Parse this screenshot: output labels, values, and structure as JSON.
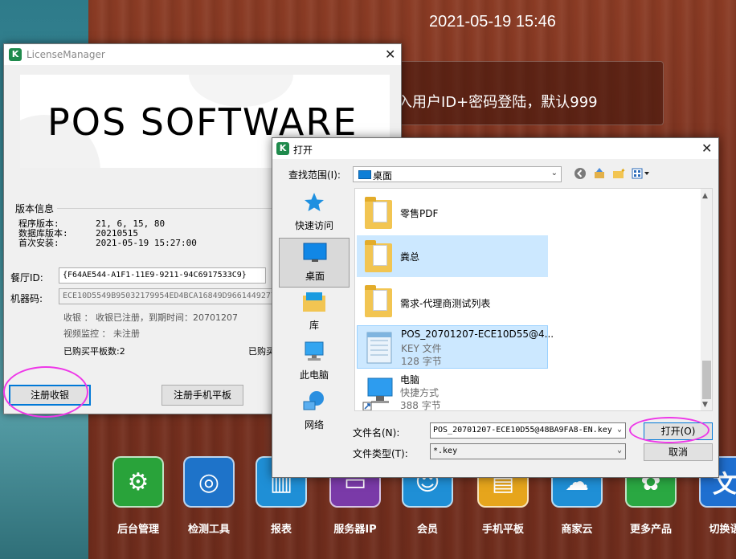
{
  "desktop": {
    "clock": "2021-05-19 15:46",
    "login_hint": "入用户ID+密码登陆，默认999",
    "dock": [
      {
        "label": "后台管理",
        "color": "#29a33a",
        "glyph": "⚙"
      },
      {
        "label": "检测工具",
        "color": "#1e73c9",
        "glyph": "◎"
      },
      {
        "label": "报表",
        "color": "#1f8fd6",
        "glyph": "▥"
      },
      {
        "label": "服务器IP",
        "color": "#7a3aa8",
        "glyph": "▭"
      },
      {
        "label": "会员",
        "color": "#1f8fd6",
        "glyph": "☺"
      },
      {
        "label": "手机平板",
        "color": "#e6a51c",
        "glyph": "▤"
      },
      {
        "label": "商家云",
        "color": "#1f8fd6",
        "glyph": "☁"
      },
      {
        "label": "更多产品",
        "color": "#2aa842",
        "glyph": "✿"
      },
      {
        "label": "切换语",
        "color": "#1f6fd0",
        "glyph": "文"
      }
    ]
  },
  "license_manager": {
    "title": "LicenseManager",
    "banner_text": "POS SOFTWARE",
    "version_group": "版本信息",
    "program_version_label": "程序版本:",
    "program_version": "21, 6, 15, 80",
    "db_version_label": "数据库版本:",
    "db_version": "20210515",
    "first_install_label": "首次安装:",
    "first_install": "2021-05-19 15:27:00",
    "restaurant_id_label": "餐厅ID:",
    "restaurant_id": "{F64AE544-A1F1-11E9-9211-94C6917533C9}",
    "machine_code_label": "机器码:",
    "machine_code": "ECE10D5549B95032179954ED4BCA16849D9661449277",
    "cashier_status": "收银 ： 收银已注册，到期时间：20701207",
    "video_status": "视频监控 ： 未注册",
    "tablets_bought": "已购买平板数:2",
    "bought_other": "已购买",
    "register_cashier_btn": "注册收银",
    "register_tablet_btn": "注册手机平板"
  },
  "open_dialog": {
    "title": "打开",
    "lookin_label": "查找范围(I):",
    "lookin_value": "桌面",
    "places": [
      {
        "label": "快速访问",
        "icon": "star-icon"
      },
      {
        "label": "桌面",
        "icon": "desktop-icon"
      },
      {
        "label": "库",
        "icon": "library-icon"
      },
      {
        "label": "此电脑",
        "icon": "computer-icon"
      },
      {
        "label": "网络",
        "icon": "network-icon"
      }
    ],
    "files": [
      {
        "name": "零售PDF",
        "kind": "folder"
      },
      {
        "name": "粪总",
        "kind": "folder"
      },
      {
        "name": "需求-代理商测试列表",
        "kind": "folder"
      },
      {
        "name": "POS_20701207-ECE10D55@4...",
        "sub1": "KEY 文件",
        "sub2": "128 字节",
        "kind": "file"
      },
      {
        "name": "电脑",
        "sub1": "快捷方式",
        "sub2": "388 字节",
        "kind": "shortcut"
      }
    ],
    "filename_label": "文件名(N):",
    "filename_value": "POS_20701207-ECE10D55@48BA9FA8-EN.key",
    "filetype_label": "文件类型(T):",
    "filetype_value": "*.key",
    "open_btn": "打开(O)",
    "cancel_btn": "取消"
  },
  "colors": {
    "highlight_circle": "#ee38e8",
    "selection": "#cce8ff",
    "focus_blue": "#0078d7"
  }
}
